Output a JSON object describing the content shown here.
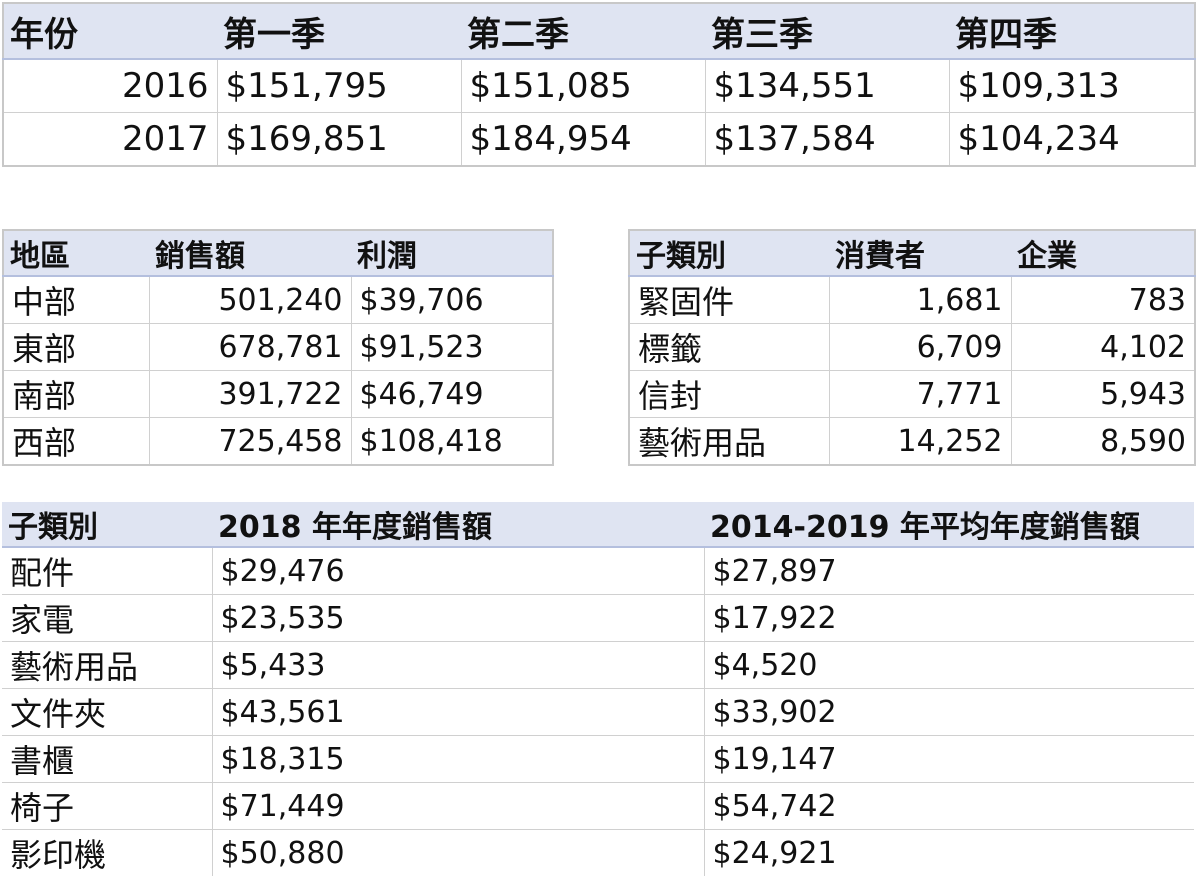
{
  "quarterly": {
    "headers": [
      "年份",
      "第一季",
      "第二季",
      "第三季",
      "第四季"
    ],
    "currency": "$",
    "rows": [
      {
        "year": "2016",
        "q": [
          "151,795",
          "151,085",
          "134,551",
          "109,313"
        ]
      },
      {
        "year": "2017",
        "q": [
          "169,851",
          "184,954",
          "137,584",
          "104,234"
        ]
      }
    ]
  },
  "regions": {
    "headers": [
      "地區",
      "銷售額",
      "利潤"
    ],
    "currency": "$",
    "rows": [
      {
        "region": "中部",
        "sales": "501,240",
        "profit": "39,706"
      },
      {
        "region": "東部",
        "sales": "678,781",
        "profit": "91,523"
      },
      {
        "region": "南部",
        "sales": "391,722",
        "profit": "46,749"
      },
      {
        "region": "西部",
        "sales": "725,458",
        "profit": "108,418"
      }
    ]
  },
  "segments": {
    "headers": [
      "子類別",
      "消費者",
      "企業"
    ],
    "rows": [
      {
        "sub": "緊固件",
        "consumer": "1,681",
        "corporate": "783"
      },
      {
        "sub": "標籤",
        "consumer": "6,709",
        "corporate": "4,102"
      },
      {
        "sub": "信封",
        "consumer": "7,771",
        "corporate": "5,943"
      },
      {
        "sub": "藝術用品",
        "consumer": "14,252",
        "corporate": "8,590"
      }
    ]
  },
  "annual": {
    "headers": [
      "子類別",
      "2018 年年度銷售額",
      "2014-2019 年平均年度銷售額"
    ],
    "currency": "$",
    "rows": [
      {
        "sub": "配件",
        "y2018": "29,476",
        "avg": "27,897"
      },
      {
        "sub": "家電",
        "y2018": "23,535",
        "avg": "17,922"
      },
      {
        "sub": "藝術用品",
        "y2018": "5,433",
        "avg": "4,520"
      },
      {
        "sub": "文件夾",
        "y2018": "43,561",
        "avg": "33,902"
      },
      {
        "sub": "書櫃",
        "y2018": "18,315",
        "avg": "19,147"
      },
      {
        "sub": "椅子",
        "y2018": "71,449",
        "avg": "54,742"
      },
      {
        "sub": "影印機",
        "y2018": "50,880",
        "avg": "24,921"
      }
    ]
  },
  "colors": {
    "header_bg": "#dfe4f2",
    "grid": "#d0d0d0",
    "border": "#c8c8c8"
  }
}
